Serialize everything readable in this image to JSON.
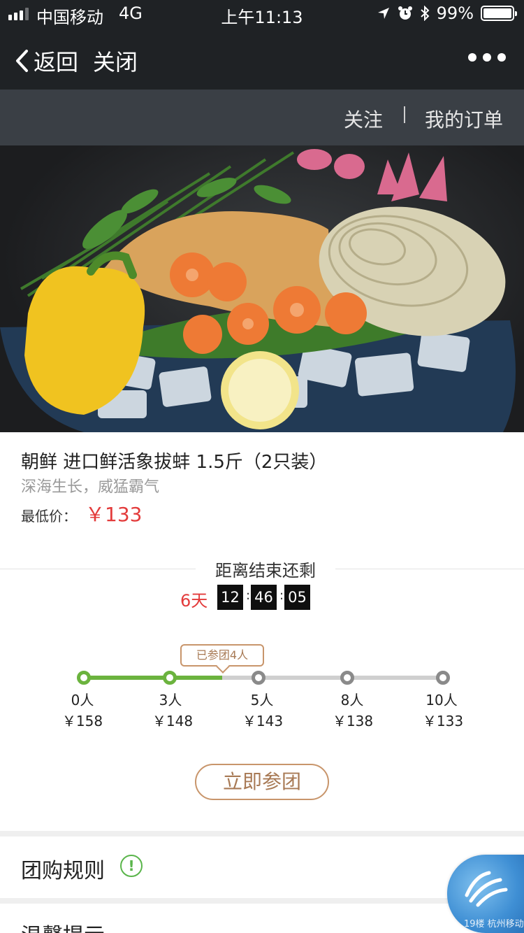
{
  "status_bar": {
    "carrier": "中国移动",
    "network": "4G",
    "time": "上午11:13",
    "battery": "99%"
  },
  "nav": {
    "back_label": "返回",
    "close_label": "关闭"
  },
  "sub_nav": {
    "follow_label": "关注",
    "separator": "I",
    "orders_label": "我的订单"
  },
  "product": {
    "title": "朝鲜 进口鲜活象拔蚌 1.5斤（2只装）",
    "subtitle": "深海生长，威猛霸气",
    "lowest_price_label": "最低价：",
    "lowest_price": "￥133"
  },
  "countdown": {
    "title": "距离结束还剩",
    "days": "6天",
    "hours": "12",
    "minutes": "46",
    "seconds": "05",
    "colon": ":"
  },
  "progress": {
    "joined_badge": "已参团4人",
    "joined_count": 4,
    "tiers": [
      {
        "count": "0人",
        "price": "￥158",
        "reached": true
      },
      {
        "count": "3人",
        "price": "￥148",
        "reached": true
      },
      {
        "count": "5人",
        "price": "￥143",
        "reached": false
      },
      {
        "count": "8人",
        "price": "￥138",
        "reached": false
      },
      {
        "count": "10人",
        "price": "￥133",
        "reached": false
      }
    ]
  },
  "join_button_label": "立即参团",
  "rules_title": "团购规则",
  "rules_icon_glyph": "!",
  "tips_title": "温馨提示",
  "watermark": "19楼 杭州移动",
  "colors": {
    "accent_red": "#e33b3b",
    "progress_green": "#6bb33e",
    "button_gold": "#c8956b"
  }
}
